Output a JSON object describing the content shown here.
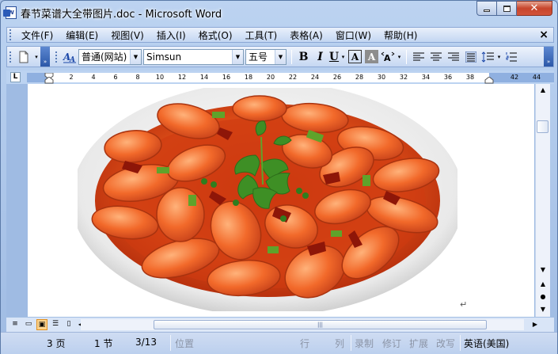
{
  "window": {
    "title": "春节菜谱大全带图片.doc - Microsoft Word",
    "icon": "word-doc-icon",
    "icon_letter": "W"
  },
  "menu": {
    "items": [
      "文件(F)",
      "编辑(E)",
      "视图(V)",
      "插入(I)",
      "格式(O)",
      "工具(T)",
      "表格(A)",
      "窗口(W)",
      "帮助(H)"
    ],
    "close_label": "×"
  },
  "toolbar": {
    "style_value": "普通(网站)",
    "font_value": "Simsun",
    "size_value": "五号",
    "bold": "B",
    "italic": "I",
    "underline": "U",
    "char_border": "A",
    "char_shading": "A"
  },
  "ruler": {
    "corner": "L",
    "numbers": [
      "2",
      "4",
      "6",
      "8",
      "10",
      "12",
      "14",
      "16",
      "18",
      "20",
      "22",
      "24",
      "26",
      "28",
      "30",
      "32",
      "34",
      "36",
      "38",
      "42",
      "44"
    ]
  },
  "document": {
    "paragraph_mark": "↵",
    "image_subject": "red braised shrimp dish with cilantro and chili in white bowl"
  },
  "statusbar": {
    "page": "3 页",
    "section": "1 节",
    "page_of": "3/13",
    "position": "位置",
    "line": "行",
    "column": "列",
    "rec": "录制",
    "trk": "修订",
    "ext": "扩展",
    "ovr": "改写",
    "language": "英语(美国)"
  },
  "colors": {
    "window_frame": "#bcd3f1",
    "toolbar_bg": "#c5d7f2",
    "accent_blue": "#2b57a8",
    "close_red": "#c7452c"
  }
}
